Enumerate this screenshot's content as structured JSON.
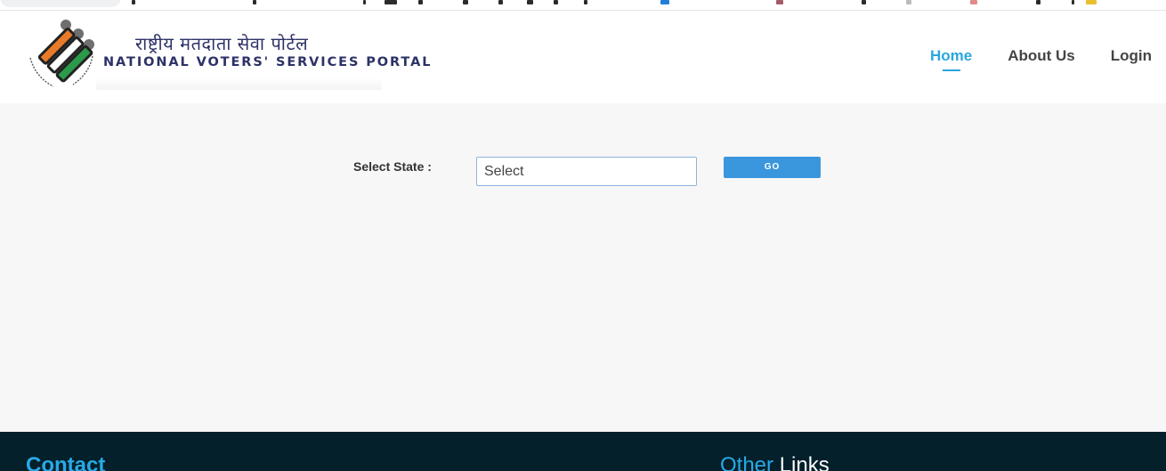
{
  "header": {
    "brand_hindi": "राष्ट्रीय मतदाता सेवा पोर्टल",
    "brand_english": "NATIONAL VOTERS' SERVICES PORTAL",
    "nav": [
      {
        "label": "Home"
      },
      {
        "label": "About Us"
      },
      {
        "label": "Login"
      }
    ]
  },
  "form": {
    "state_label": "Select State :",
    "state_select_value": "Select",
    "go_label": "GO"
  },
  "footer": {
    "contact_heading": "Contact",
    "other_links_heading_part1": "Other",
    "other_links_heading_part2": "Links"
  },
  "colors": {
    "accent": "#2aa6e0",
    "button": "#3a96dd",
    "footer_bg": "#03202b",
    "brand_navy": "#2c3266"
  }
}
